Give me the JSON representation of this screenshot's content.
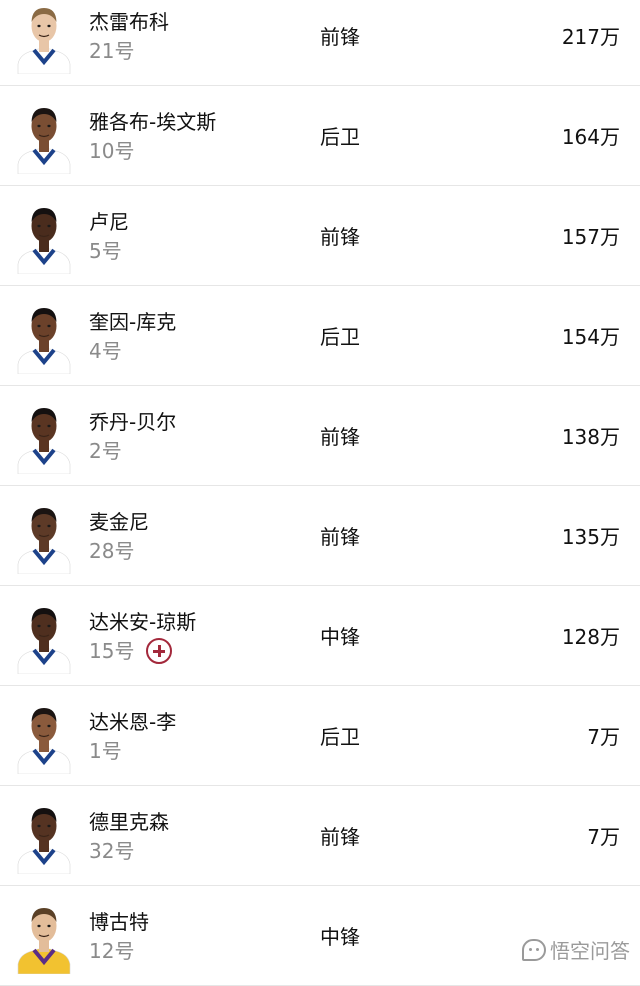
{
  "players": [
    {
      "name": "杰雷布科",
      "number": "21号",
      "position": "前锋",
      "salary": "217万",
      "skin": "#e8c6a8",
      "hair": "#8a6a44",
      "jersey": "#ffffff",
      "trim": "#1d428a",
      "injured": false
    },
    {
      "name": "雅各布-埃文斯",
      "number": "10号",
      "position": "后卫",
      "salary": "164万",
      "skin": "#7a4e33",
      "hair": "#1b1412",
      "jersey": "#ffffff",
      "trim": "#1d428a",
      "injured": false
    },
    {
      "name": "卢尼",
      "number": "5号",
      "position": "前锋",
      "salary": "157万",
      "skin": "#4a2c1d",
      "hair": "#141010",
      "jersey": "#ffffff",
      "trim": "#1d428a",
      "injured": false
    },
    {
      "name": "奎因-库克",
      "number": "4号",
      "position": "后卫",
      "salary": "154万",
      "skin": "#6b412a",
      "hair": "#141010",
      "jersey": "#ffffff",
      "trim": "#1d428a",
      "injured": false
    },
    {
      "name": "乔丹-贝尔",
      "number": "2号",
      "position": "前锋",
      "salary": "138万",
      "skin": "#5a3522",
      "hair": "#141010",
      "jersey": "#ffffff",
      "trim": "#1d428a",
      "injured": false
    },
    {
      "name": "麦金尼",
      "number": "28号",
      "position": "前锋",
      "salary": "135万",
      "skin": "#5d3a27",
      "hair": "#1b1412",
      "jersey": "#ffffff",
      "trim": "#1d428a",
      "injured": false
    },
    {
      "name": "达米安-琼斯",
      "number": "15号",
      "position": "中锋",
      "salary": "128万",
      "skin": "#4f2f1f",
      "hair": "#141010",
      "jersey": "#ffffff",
      "trim": "#1d428a",
      "injured": true
    },
    {
      "name": "达米恩-李",
      "number": "1号",
      "position": "后卫",
      "salary": "7万",
      "skin": "#8a5a3c",
      "hair": "#1b1412",
      "jersey": "#ffffff",
      "trim": "#1d428a",
      "injured": false
    },
    {
      "name": "德里克森",
      "number": "32号",
      "position": "前锋",
      "salary": "7万",
      "skin": "#553322",
      "hair": "#141010",
      "jersey": "#ffffff",
      "trim": "#1d428a",
      "injured": false
    },
    {
      "name": "博古特",
      "number": "12号",
      "position": "中锋",
      "salary": "",
      "skin": "#e3bd9a",
      "hair": "#5a4026",
      "jersey": "#f2c230",
      "trim": "#5b2d86",
      "injured": false
    }
  ],
  "watermark": {
    "text": "悟空问答"
  },
  "colors": {
    "injury": "#a3283b",
    "divider": "#e6e6e6"
  }
}
